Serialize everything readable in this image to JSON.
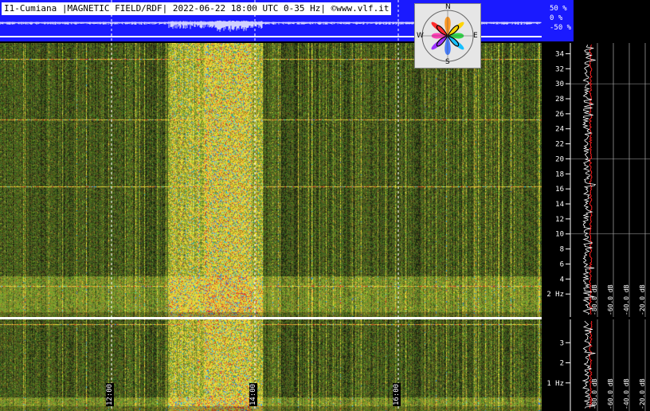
{
  "chart_data": {
    "type": "heatmap",
    "title": "I1-Cumiana |MAGNETIC FIELD/RDF| 2022-06-22 18:00 UTC 0-35 Hz| ©www.vlf.it",
    "time_ticks": [
      "12:00",
      "14:00",
      "16:00"
    ],
    "amplitude_ticks": [
      "50 %",
      "0 %",
      "-50 %"
    ],
    "upper_panel": {
      "yunit": "Hz",
      "ylim": [
        0,
        35
      ],
      "y_ticks": [
        2,
        4,
        6,
        8,
        10,
        12,
        14,
        16,
        18,
        20,
        22,
        24,
        26,
        28,
        30,
        32,
        34
      ],
      "y_tick_labels": [
        "2 Hz",
        "4",
        "6",
        "8",
        "10",
        "12",
        "14",
        "16",
        "18",
        "20",
        "22",
        "24",
        "26",
        "28",
        "30",
        "32",
        "34"
      ],
      "db_labels": [
        "-80.0 dB",
        "-60.0 dB",
        "-40.0 dB",
        "-20.0 dB"
      ]
    },
    "lower_panel": {
      "yunit": "Hz",
      "ylim": [
        0,
        4
      ],
      "y_ticks": [
        1,
        2,
        3
      ],
      "y_tick_labels": [
        "1 Hz",
        "2",
        "3"
      ],
      "db_labels": [
        "-80.0 dB",
        "-60.0 dB",
        "-40.0 dB",
        "-20.0 dB"
      ]
    },
    "colors": {
      "header": "#1a1aff",
      "grid": "#ffffff"
    }
  },
  "compass": {
    "N": "N",
    "S": "S",
    "E": "E",
    "W": "W"
  }
}
